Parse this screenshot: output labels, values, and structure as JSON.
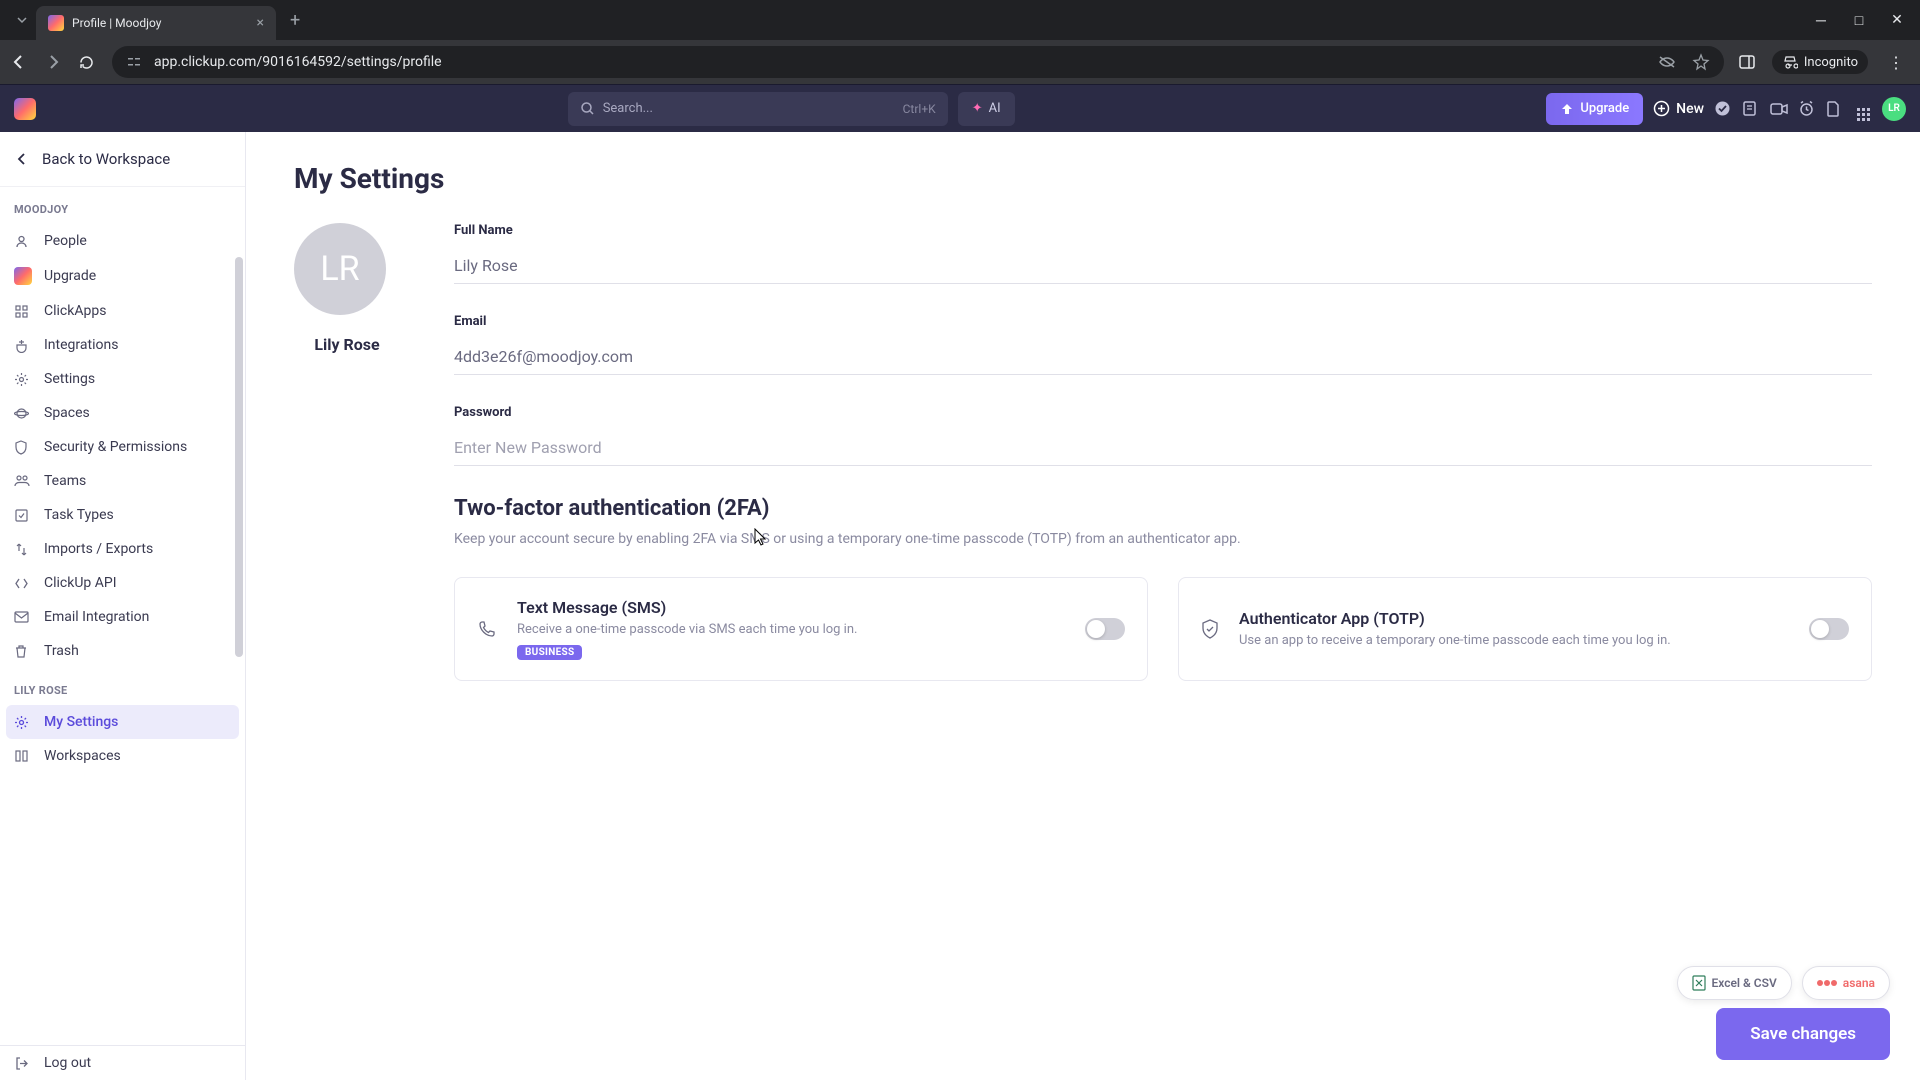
{
  "browser": {
    "tab_title": "Profile | Moodjoy",
    "url": "app.clickup.com/9016164592/settings/profile",
    "incognito_label": "Incognito"
  },
  "header": {
    "search_placeholder": "Search...",
    "search_shortcut": "Ctrl+K",
    "ai_label": "AI",
    "upgrade_label": "Upgrade",
    "new_label": "New",
    "avatar_initials": "LR"
  },
  "sidebar": {
    "back_label": "Back to Workspace",
    "section1": "MOODJOY",
    "items1": [
      {
        "label": "People"
      },
      {
        "label": "Upgrade"
      },
      {
        "label": "ClickApps"
      },
      {
        "label": "Integrations"
      },
      {
        "label": "Settings"
      },
      {
        "label": "Spaces"
      },
      {
        "label": "Security & Permissions"
      },
      {
        "label": "Teams"
      },
      {
        "label": "Task Types"
      },
      {
        "label": "Imports / Exports"
      },
      {
        "label": "ClickUp API"
      },
      {
        "label": "Email Integration"
      },
      {
        "label": "Trash"
      }
    ],
    "section2": "LILY ROSE",
    "items2": [
      {
        "label": "My Settings"
      },
      {
        "label": "Workspaces"
      }
    ],
    "logout": "Log out"
  },
  "page": {
    "title": "My Settings",
    "avatar_initials": "LR",
    "profile_name": "Lily Rose",
    "fields": {
      "full_name_label": "Full Name",
      "full_name_value": "Lily Rose",
      "email_label": "Email",
      "email_value": "4dd3e26f@moodjoy.com",
      "password_label": "Password",
      "password_placeholder": "Enter New Password"
    },
    "tfa": {
      "title": "Two-factor authentication (2FA)",
      "desc": "Keep your account secure by enabling 2FA via SMS or using a temporary one-time passcode (TOTP) from an authenticator app.",
      "sms_title": "Text Message (SMS)",
      "sms_desc": "Receive a one-time passcode via SMS each time you log in.",
      "sms_badge": "BUSINESS",
      "totp_title": "Authenticator App (TOTP)",
      "totp_desc": "Use an app to receive a temporary one-time passcode each time you log in."
    },
    "chips": {
      "excel": "Excel & CSV",
      "asana": "asana"
    },
    "save_label": "Save changes"
  }
}
